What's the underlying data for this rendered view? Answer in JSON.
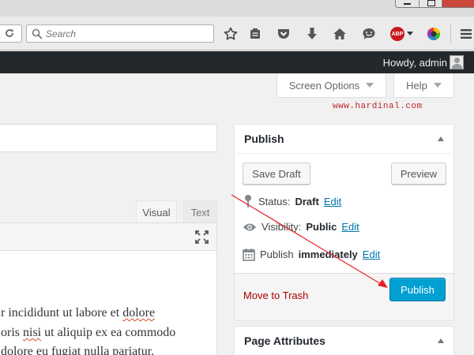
{
  "browser": {
    "search_placeholder": "Search",
    "toolbar_icons": [
      "bookmark-star-icon",
      "reading-list-icon",
      "pocket-icon",
      "download-icon",
      "home-icon",
      "chat-icon",
      "adblock-plus-icon",
      "color-wheel-icon",
      "hamburger-menu-icon"
    ],
    "abp_label": "ABP"
  },
  "admin_bar": {
    "greeting": "Howdy, admin"
  },
  "screen_meta": {
    "screen_options_label": "Screen Options",
    "help_label": "Help"
  },
  "watermark": "www.hardinal.com",
  "editor": {
    "tab_visual": "Visual",
    "tab_text": "Text",
    "lines": [
      {
        "pre": "r incididunt ut labore et ",
        "err": "dolore",
        "post": ""
      },
      {
        "pre": "oris ",
        "err": "nisi",
        "post": " ut aliquip ex ea commodo"
      },
      {
        "pre": "dolore eu fugiat nulla pariatur.",
        "err": "",
        "post": ""
      }
    ]
  },
  "publish_box": {
    "title": "Publish",
    "save_draft_label": "Save Draft",
    "preview_label": "Preview",
    "status_label": "Status:",
    "status_value": "Draft",
    "visibility_label": "Visibility:",
    "visibility_value": "Public",
    "schedule_label": "Publish",
    "schedule_value": "immediately",
    "edit_label": "Edit",
    "trash_label": "Move to Trash",
    "publish_label": "Publish"
  },
  "page_attributes": {
    "title": "Page Attributes"
  },
  "colors": {
    "admin_bar": "#23282d",
    "primary_button": "#00a0d2",
    "link": "#0073aa",
    "trash": "#a00",
    "annotation_arrow": "#e8202a"
  }
}
